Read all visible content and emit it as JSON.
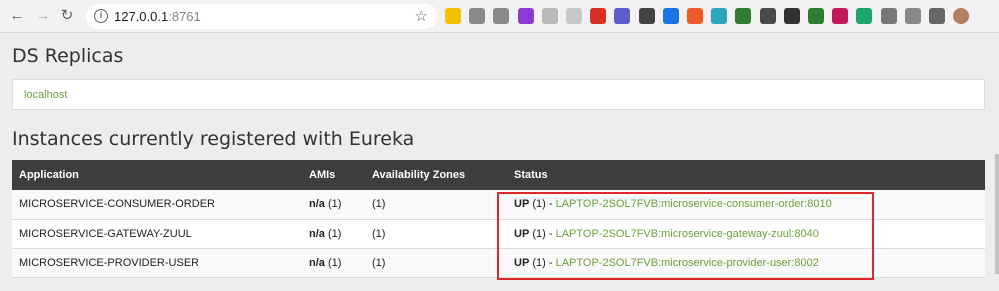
{
  "browser": {
    "url_host": "127.0.0.1",
    "url_port": ":8761",
    "extensions": [
      "ext-1",
      "ext-2",
      "ext-3",
      "ext-4",
      "ext-5",
      "ext-6",
      "ext-7",
      "ext-8",
      "ext-9",
      "ext-10",
      "ext-11",
      "ext-12",
      "ext-13",
      "ext-14",
      "ext-15",
      "ext-16",
      "ext-17",
      "ext-18",
      "ext-19",
      "ext-20",
      "ext-21",
      "ext-22"
    ]
  },
  "page": {
    "replicas_title": "DS Replicas",
    "replica": "localhost",
    "instances_title": "Instances currently registered with Eureka",
    "columns": [
      "Application",
      "AMIs",
      "Availability Zones",
      "Status"
    ],
    "rows": [
      {
        "application": "MICROSERVICE-CONSUMER-ORDER",
        "amis": "n/a",
        "amis_count": "(1)",
        "zones": "(1)",
        "status": "UP",
        "status_count": "(1) -",
        "instance": "LAPTOP-2SOL7FVB:microservice-consumer-order:8010"
      },
      {
        "application": "MICROSERVICE-GATEWAY-ZUUL",
        "amis": "n/a",
        "amis_count": "(1)",
        "zones": "(1)",
        "status": "UP",
        "status_count": "(1) -",
        "instance": "LAPTOP-2SOL7FVB:microservice-gateway-zuul:8040"
      },
      {
        "application": "MICROSERVICE-PROVIDER-USER",
        "amis": "n/a",
        "amis_count": "(1)",
        "zones": "(1)",
        "status": "UP",
        "status_count": "(1) -",
        "instance": "LAPTOP-2SOL7FVB:microservice-provider-user:8002"
      }
    ]
  },
  "colors": {
    "accent_link": "#6da13b",
    "header_bg": "#3d3d3d",
    "highlight": "#e0272b"
  }
}
